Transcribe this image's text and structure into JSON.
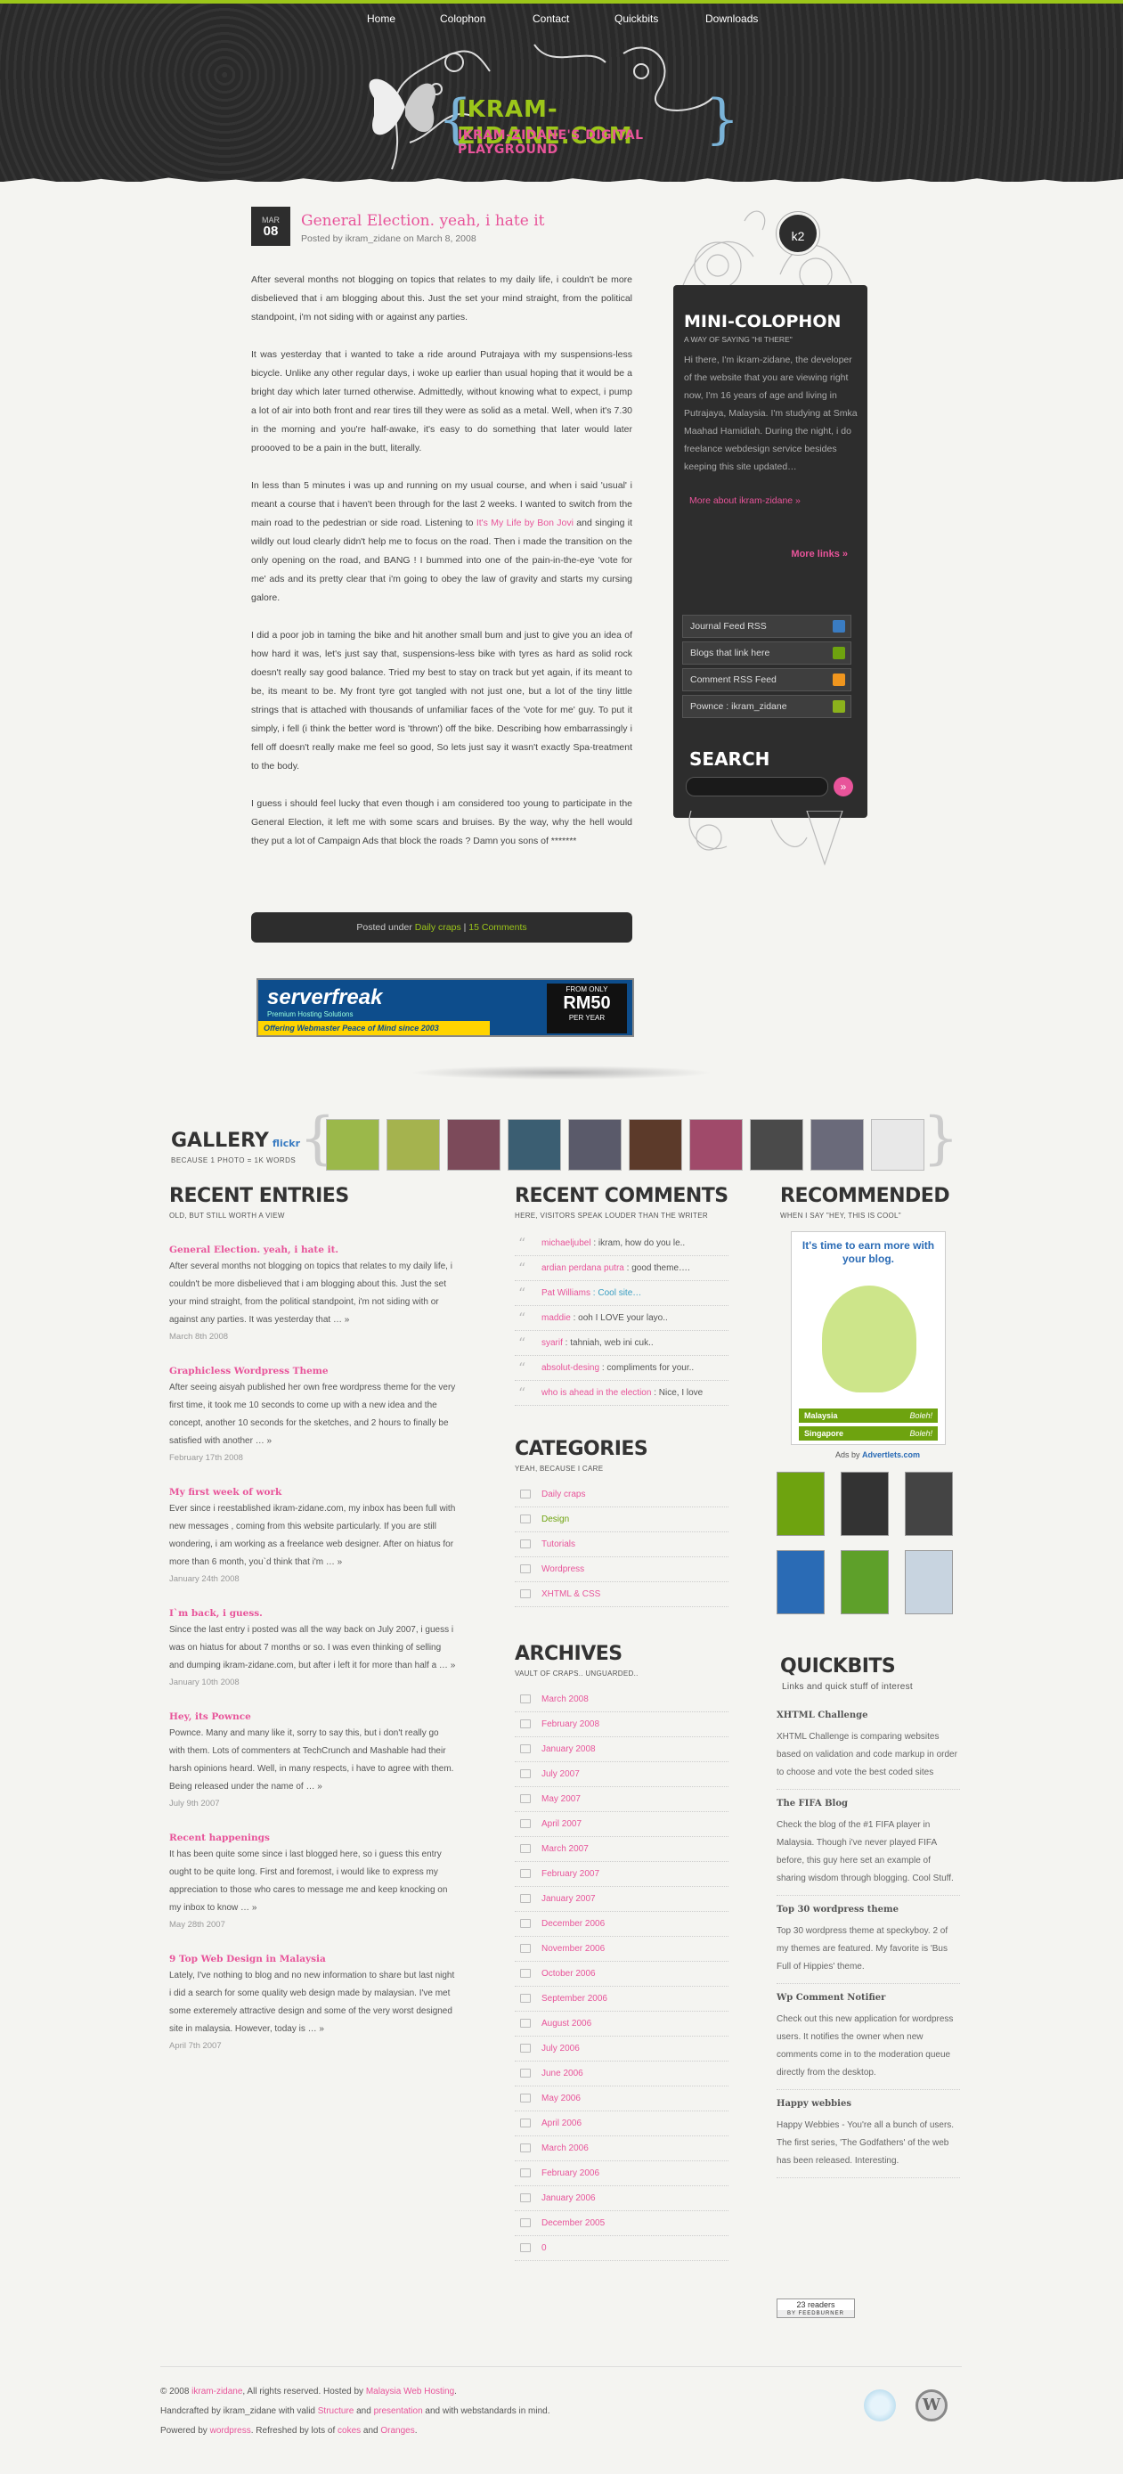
{
  "nav": {
    "items": [
      "Home",
      "Colophon",
      "Contact",
      "Quickbits",
      "Downloads"
    ]
  },
  "logo": {
    "title": "IKRAM-ZIDANE.COM",
    "subtitle": "IKRAM-ZIDANE'S DIGITAL PLAYGROUND"
  },
  "post": {
    "date_month": "MAR",
    "date_day": "08",
    "title": "General Election. yeah, i hate it",
    "meta": "Posted by ikram_zidane on March 8, 2008",
    "p1": "After several months not blogging on topics that relates to my daily life, i couldn't be more disbelieved that i am blogging about this. Just the set your mind straight, from the political standpoint, i'm not siding with or against any parties.",
    "p2": "It was yesterday that i wanted to take a ride around Putrajaya with my suspensions-less bicycle. Unlike any other regular days, i woke up earlier than usual hoping that it would be a bright day which later turned otherwise. Admittedly, without knowing what to expect, i pump a lot of air into both front and rear tires till they were as solid as a metal. Well, when it's 7.30 in the morning and you're half-awake, it's easy to do something that later would later proooved to be a pain in the butt, literally.",
    "p3a": "In less than 5 minutes i was up and running on my usual course, and when i said 'usual' i meant a course that i haven't been through for the last 2 weeks. I wanted to switch from the main road to the pedestrian or side road. Listening to ",
    "p3link": "It's My Life by Bon Jovi",
    "p3b": " and singing it wildly out loud clearly didn't help me to focus on the road. Then i made the transition on the only opening on the road, and BANG ! I bummed into one of the pain-in-the-eye 'vote for me' ads and its pretty clear that i'm going to obey the law of gravity and starts my cursing galore.",
    "p4": "I did a poor job in taming the bike and hit another small bum and just to give you an idea of how hard it was, let's just say that, suspensions-less bike with tyres as hard as solid rock doesn't really say good balance. Tried my best to stay on track but yet again, if its meant to be, its meant to be. My front tyre got tangled with not just one, but a lot of the tiny little strings that is attached with thousands of unfamiliar faces of the 'vote for me' guy. To put it simply, i fell (i think the better word is 'thrown') off the bike. Describing how embarrassingly i fell off doesn't really make me feel so good, So lets just say it wasn't exactly Spa-treatment to the body.",
    "p5": "I guess i should feel lucky that even though i am considered too young to participate in the General Election, it left me with some scars and bruises. By the way, why the hell would they put a lot of Campaign Ads that block the roads ? Damn you sons of *******",
    "footer_prefix": "Posted under ",
    "footer_cat": "Daily craps",
    "footer_sep": " | ",
    "footer_comments": "15 Comments"
  },
  "banner": {
    "brand": "serverfreak",
    "tagline": "Premium Hosting Solutions",
    "strip": "Offering Webmaster Peace of Mind since 2003",
    "from": "FROM ONLY",
    "price": "RM50",
    "per": "PER YEAR"
  },
  "sidebar": {
    "badge": "k2",
    "title": "MINI-COLOPHON",
    "subtitle": "A WAY OF SAYING \"HI THERE\"",
    "text": "Hi there, I'm ikram-zidane, the developer of the website that you are viewing right now, I'm 16 years of age and living in Putrajaya, Malaysia. I'm studying at Smka Maahad Hamidiah. During the night, i do freelance webdesign service besides keeping this site updated…",
    "more_about": "More about ikram-zidane »",
    "more_links": "More links »",
    "feeds": [
      {
        "label": "Journal Feed RSS",
        "color": "#3a7cc2"
      },
      {
        "label": "Blogs that link here",
        "color": "#6ea30f"
      },
      {
        "label": "Comment RSS Feed",
        "color": "#f0961e"
      },
      {
        "label": "Pownce : ikram_zidane",
        "color": "#8bb21c"
      }
    ],
    "search_title": "SEARCH",
    "search_value": "",
    "search_btn": "»"
  },
  "gallery": {
    "title": "GALLERY",
    "flickr": "flickr",
    "subtitle": "BECAUSE 1 PHOTO = 1K WORDS"
  },
  "recent_entries": {
    "title": "RECENT ENTRIES",
    "subtitle": "OLD, BUT STILL WORTH A VIEW",
    "items": [
      {
        "title": "General Election. yeah, i hate it.",
        "excerpt": "After several months not blogging on topics that relates to my daily life, i couldn't be more disbelieved that i am blogging about this. Just the set your mind straight, from the political standpoint, i'm not siding with or against any parties. It was yesterday that … »",
        "date": "March 8th 2008"
      },
      {
        "title": "Graphicless Wordpress Theme",
        "excerpt": "After seeing aisyah published her own free wordpress theme for the very first time, it took me 10 seconds to come up with a new idea and the concept, another 10 seconds for the sketches, and 2 hours to finally be satisfied with another … »",
        "date": "February 17th 2008"
      },
      {
        "title": "My first week of work",
        "excerpt": "Ever since i reestablished ikram-zidane.com, my inbox has been full with new messages , coming from this website particularly. If you are still wondering, i am working as a freelance web designer. After on hiatus for more than 6 month, you`d think that i'm … »",
        "date": "January 24th 2008"
      },
      {
        "title": "I`m back, i guess.",
        "excerpt": "Since the last entry i posted was all the way back on July 2007, i guess i was on hiatus for about 7 months or so. I was even thinking of selling and dumping ikram-zidane.com, but after i left it for more than half a … »",
        "date": "January 10th 2008"
      },
      {
        "title": "Hey, its Pownce",
        "excerpt": "Pownce. Many and many like it, sorry to say this, but i don't really go with them. Lots of commenters at TechCrunch and Mashable had their harsh opinions heard. Well, in many respects, i have to agree with them. Being released under the name of … »",
        "date": "July 9th 2007"
      },
      {
        "title": "Recent happenings",
        "excerpt": "It has been quite some since i last blogged here, so i guess this entry ought to be quite long. First and foremost, i would like to express my appreciation to those who cares to message me and keep knocking on my inbox to know … »",
        "date": "May 28th 2007"
      },
      {
        "title": "9 Top Web Design in Malaysia",
        "excerpt": "Lately, I've nothing to blog and no new information to share but last night i did a search for some quality web design made by malaysian. I've met some exteremely attractive design and some of the very worst designed site in malaysia. However, today is … »",
        "date": "April 7th 2007"
      }
    ]
  },
  "recent_comments": {
    "title": "RECENT COMMENTS",
    "subtitle": "HERE, VISITORS SPEAK LOUDER THAN THE WRITER",
    "items": [
      {
        "author": "michaeljubel",
        "text": " : ikram, how do you le.."
      },
      {
        "author": "ardian perdana putra",
        "text": " : good theme…."
      },
      {
        "author": "Pat Williams",
        "text": " : Cool site…"
      },
      {
        "author": "maddie",
        "text": " : ooh I LOVE your layo.."
      },
      {
        "author": "syarif",
        "text": " : tahniah, web ini cuk.."
      },
      {
        "author": "absolut-desing",
        "text": " : compliments for your.."
      },
      {
        "author": "who is ahead in the election",
        "text": " : Nice, I love"
      }
    ]
  },
  "categories": {
    "title": "CATEGORIES",
    "subtitle": "YEAH, BECAUSE I CARE",
    "items": [
      "Daily craps",
      "Design",
      "Tutorials",
      "Wordpress",
      "XHTML & CSS"
    ]
  },
  "archives": {
    "title": "ARCHIVES",
    "subtitle": "VAULT OF CRAPS.. UNGUARDED..",
    "items": [
      "March 2008",
      "February 2008",
      "January 2008",
      "July 2007",
      "May 2007",
      "April 2007",
      "March 2007",
      "February 2007",
      "January 2007",
      "December 2006",
      "November 2006",
      "October 2006",
      "September 2006",
      "August 2006",
      "July 2006",
      "June 2006",
      "May 2006",
      "April 2006",
      "March 2006",
      "February 2006",
      "January 2006",
      "December 2005",
      "0"
    ]
  },
  "recommended": {
    "title": "RECOMMENDED",
    "subtitle": "WHEN I SAY \"HEY, THIS IS COOL\"",
    "ad_headline": "It's time to earn more with your blog.",
    "row1_country": "Malaysia",
    "row1_word": "Boleh!",
    "row2_country": "Singapore",
    "row2_word": "Boleh!",
    "ads_by": "Ads by",
    "advertlets": "Advertlets.com"
  },
  "quickbits": {
    "title": "QUICKBITS",
    "subtitle": "Links and quick stuff of interest",
    "items": [
      {
        "title": "XHTML Challenge",
        "text": "XHTML Challenge is comparing websites based on validation and code markup in order to choose and vote the best coded sites"
      },
      {
        "title": "The FIFA Blog",
        "text": "Check the blog of the #1 FIFA player in Malaysia. Though i've never played FIFA before, this guy here set an example of sharing wisdom through blogging. Cool Stuff."
      },
      {
        "title": "Top 30 wordpress theme",
        "text": "Top 30 wordpress theme at speckyboy. 2 of my themes are featured. My favorite is 'Bus Full of Hippies' theme."
      },
      {
        "title": "Wp Comment Notifier",
        "text": "Check out this new application for wordpress users. It notifies the owner when new comments come in to the moderation queue directly from the desktop."
      },
      {
        "title": "Happy webbies",
        "text": "Happy Webbies - You're all a bunch of users. The first series, 'The Godfathers' of the web has been released. Interesting."
      }
    ],
    "readers": "23 readers",
    "feedburner": "BY FEEDBURNER"
  },
  "footer": {
    "l1a": "© 2008 ",
    "l1b": "ikram-zidane",
    "l1c": ", All rights reserved. Hosted by ",
    "l1d": "Malaysia Web Hosting",
    "l1e": ".",
    "l2a": "Handcrafted by ikram_zidane with valid ",
    "l2b": "Structure",
    "l2c": " and ",
    "l2d": "presentation",
    "l2e": " and with webstandards in mind.",
    "l3a": "Powered by ",
    "l3b": "wordpress",
    "l3c": ". Refreshed by lots of ",
    "l3d": "cokes",
    "l3e": " and ",
    "l3f": "Oranges",
    "l3g": "."
  },
  "colors": {
    "accent_pink": "#e8549a",
    "accent_green": "#9cc61a",
    "dark": "#2d2d2d"
  }
}
